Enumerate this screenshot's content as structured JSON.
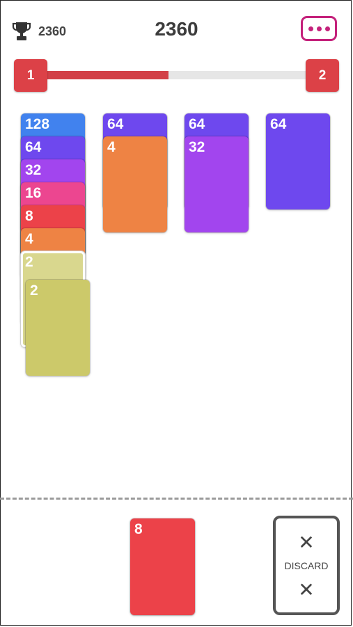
{
  "header": {
    "best_score": "2360",
    "score": "2360",
    "trophy_icon": "trophy-icon",
    "menu_icon": "more-dots-icon"
  },
  "progress": {
    "current_level": "1",
    "next_level": "2",
    "fraction": 0.46,
    "fill_color": "#d24047"
  },
  "columns": [
    {
      "cards": [
        {
          "value": "128",
          "color": "#4182ee"
        },
        {
          "value": "64",
          "color": "#6e48ee"
        },
        {
          "value": "32",
          "color": "#a245ee"
        },
        {
          "value": "16",
          "color": "#ec4690"
        },
        {
          "value": "8",
          "color": "#ec4249"
        },
        {
          "value": "4",
          "color": "#ee8344"
        },
        {
          "value": "2",
          "color": "#d9d78e",
          "ghost": true
        }
      ]
    },
    {
      "cards": [
        {
          "value": "64",
          "color": "#6e48ee"
        },
        {
          "value": "4",
          "color": "#ee8344"
        }
      ]
    },
    {
      "cards": [
        {
          "value": "64",
          "color": "#6e48ee"
        },
        {
          "value": "32",
          "color": "#a245ee"
        }
      ]
    },
    {
      "cards": [
        {
          "value": "64",
          "color": "#6e48ee"
        }
      ]
    }
  ],
  "dragging_card": {
    "value": "2",
    "color": "#ccc96a"
  },
  "next_card": {
    "value": "8",
    "color": "#ec4249"
  },
  "discard": {
    "label": "DISCARD",
    "icon": "close-icon",
    "symbol": "✕"
  }
}
